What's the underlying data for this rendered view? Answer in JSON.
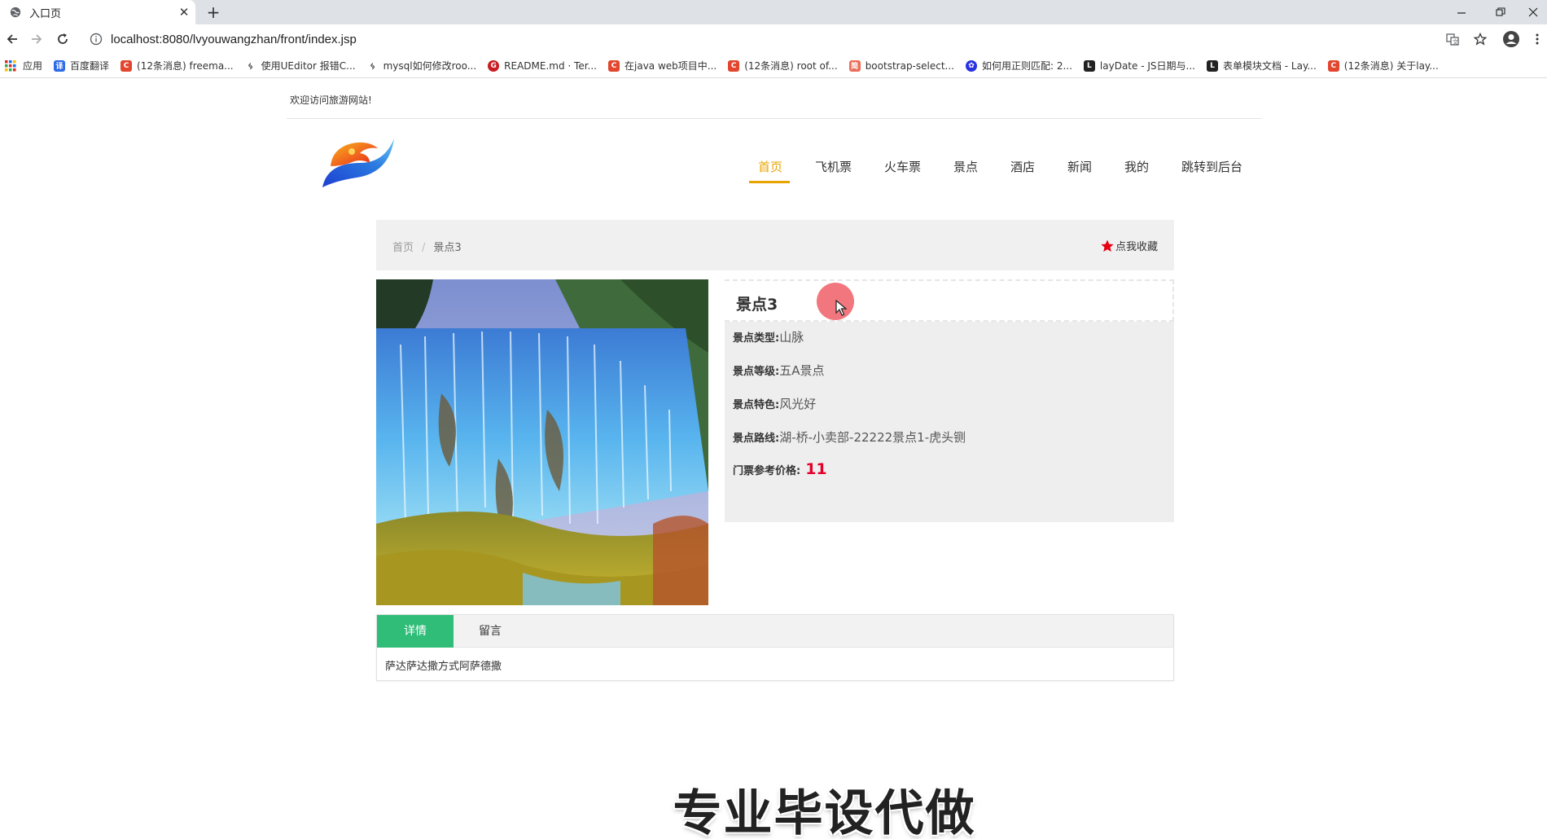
{
  "browser": {
    "tab_title": "入口页",
    "url": "localhost:8080/lvyouwangzhan/front/index.jsp",
    "bookmarks": [
      {
        "label": "应用",
        "icon": "apps-grid-icon",
        "color": "#d93025"
      },
      {
        "label": "百度翻译",
        "icon": "translate-icon",
        "color": "#2e6be6"
      },
      {
        "label": "(12条消息) freema...",
        "icon": "csdn-icon",
        "color": "#e3462f"
      },
      {
        "label": "使用UEditor 报错C...",
        "icon": "ueditor-icon",
        "color": "#333333"
      },
      {
        "label": "mysql如何修改roo...",
        "icon": "ueditor-icon",
        "color": "#333333"
      },
      {
        "label": "README.md · Ter...",
        "icon": "gitee-icon",
        "color": "#c71d23"
      },
      {
        "label": "在java web项目中...",
        "icon": "csdn-icon",
        "color": "#e3462f"
      },
      {
        "label": "(12条消息) root of...",
        "icon": "csdn-icon",
        "color": "#e3462f"
      },
      {
        "label": "bootstrap-select...",
        "icon": "jianshu-icon",
        "color": "#ea6f5a"
      },
      {
        "label": "如何用正则匹配: 2...",
        "icon": "baidu-paw-icon",
        "color": "#2932e1"
      },
      {
        "label": "layDate - JS日期与...",
        "icon": "layui-icon",
        "color": "#222222"
      },
      {
        "label": "表单模块文档 - Lay...",
        "icon": "layui-icon",
        "color": "#222222"
      },
      {
        "label": "(12条消息) 关于lay...",
        "icon": "csdn-icon",
        "color": "#e3462f"
      }
    ]
  },
  "page": {
    "welcome": "欢迎访问旅游网站!",
    "nav": [
      "首页",
      "飞机票",
      "火车票",
      "景点",
      "酒店",
      "新闻",
      "我的",
      "跳转到后台"
    ],
    "active_nav": "首页",
    "accent_color": "#e8a500",
    "breadcrumb": {
      "home": "首页",
      "sep": "/",
      "current": "景点3"
    },
    "favorite_label": "点我收藏",
    "spot": {
      "name": "景点3",
      "type_label": "景点类型:",
      "type": "山脉",
      "level_label": "景点等级:",
      "level": "五A景点",
      "feature_label": "景点特色:",
      "feature": "风光好",
      "route_label": "景点路线:",
      "route": "湖-桥-小卖部-22222景点1-虎头铡",
      "price_label": "门票参考价格:",
      "price": "11"
    },
    "tabs": [
      "详情",
      "留言"
    ],
    "active_tab_color": "#2fbd78",
    "detail_text": "萨达萨达撒方式阿萨德撒"
  },
  "overlay": {
    "watermark": "专业毕设代做"
  }
}
